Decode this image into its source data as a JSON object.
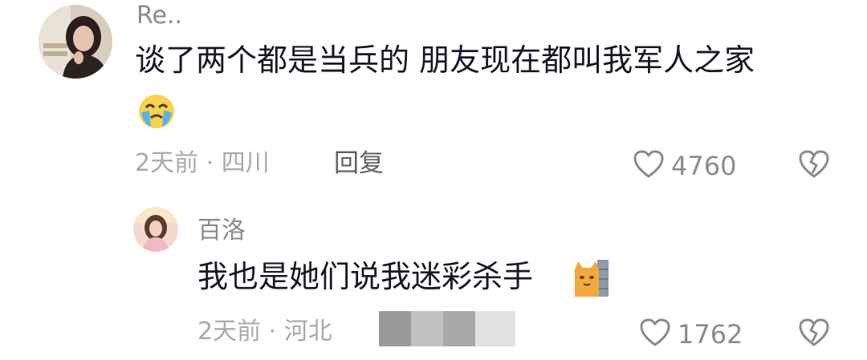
{
  "comments": [
    {
      "username": "Re..",
      "text": "谈了两个都是当兵的 朋友现在都叫我军人之家",
      "emoji": "crying-face-emoji",
      "meta": "2天前 · 四川",
      "reply_label": "回复",
      "like_count": "4760"
    }
  ],
  "replies": [
    {
      "username": "百洛",
      "text": "我也是她们说我迷彩杀手",
      "emoji": "cat-emoji",
      "meta": "2天前 · 河北",
      "like_count": "1762"
    }
  ],
  "colors": {
    "username": "#8a8b91",
    "meta": "#a8a9ae",
    "text": "#161823",
    "icon": "#8a8b91"
  }
}
